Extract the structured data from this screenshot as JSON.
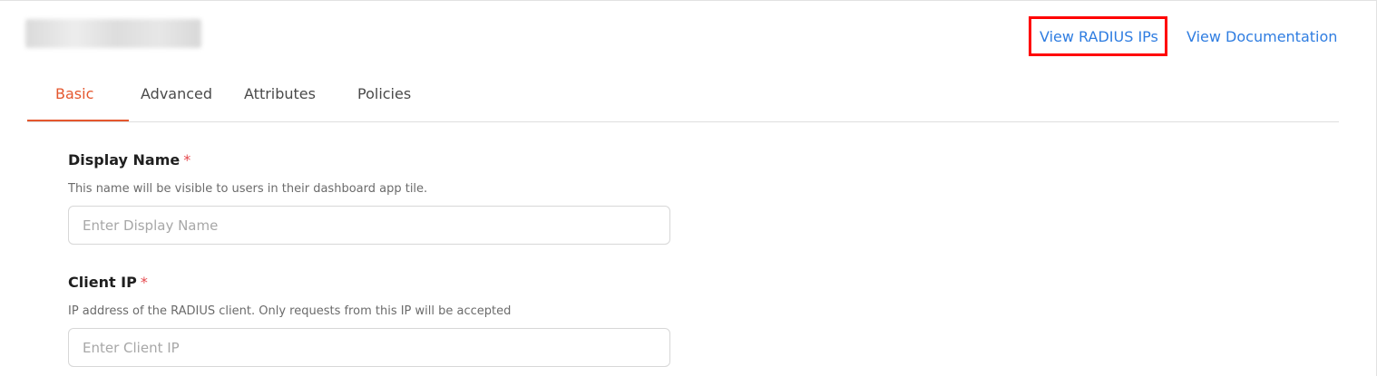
{
  "header": {
    "app_title": "",
    "links": {
      "view_radius_ips": "View RADIUS IPs",
      "view_documentation": "View Documentation"
    }
  },
  "tabs": [
    {
      "label": "Basic",
      "active": true
    },
    {
      "label": "Advanced",
      "active": false
    },
    {
      "label": "Attributes",
      "active": false
    },
    {
      "label": "Policies",
      "active": false
    }
  ],
  "form": {
    "display_name": {
      "label": "Display Name",
      "required_mark": "*",
      "help": "This name will be visible to users in their dashboard app tile.",
      "placeholder": "Enter Display Name",
      "value": ""
    },
    "client_ip": {
      "label": "Client IP",
      "required_mark": "*",
      "help": "IP address of the RADIUS client. Only requests from this IP will be accepted",
      "placeholder": "Enter Client IP",
      "value": ""
    }
  },
  "colors": {
    "accent": "#e4572e",
    "link": "#2f7de1",
    "highlight": "#ff0000",
    "required": "#e5484d"
  }
}
